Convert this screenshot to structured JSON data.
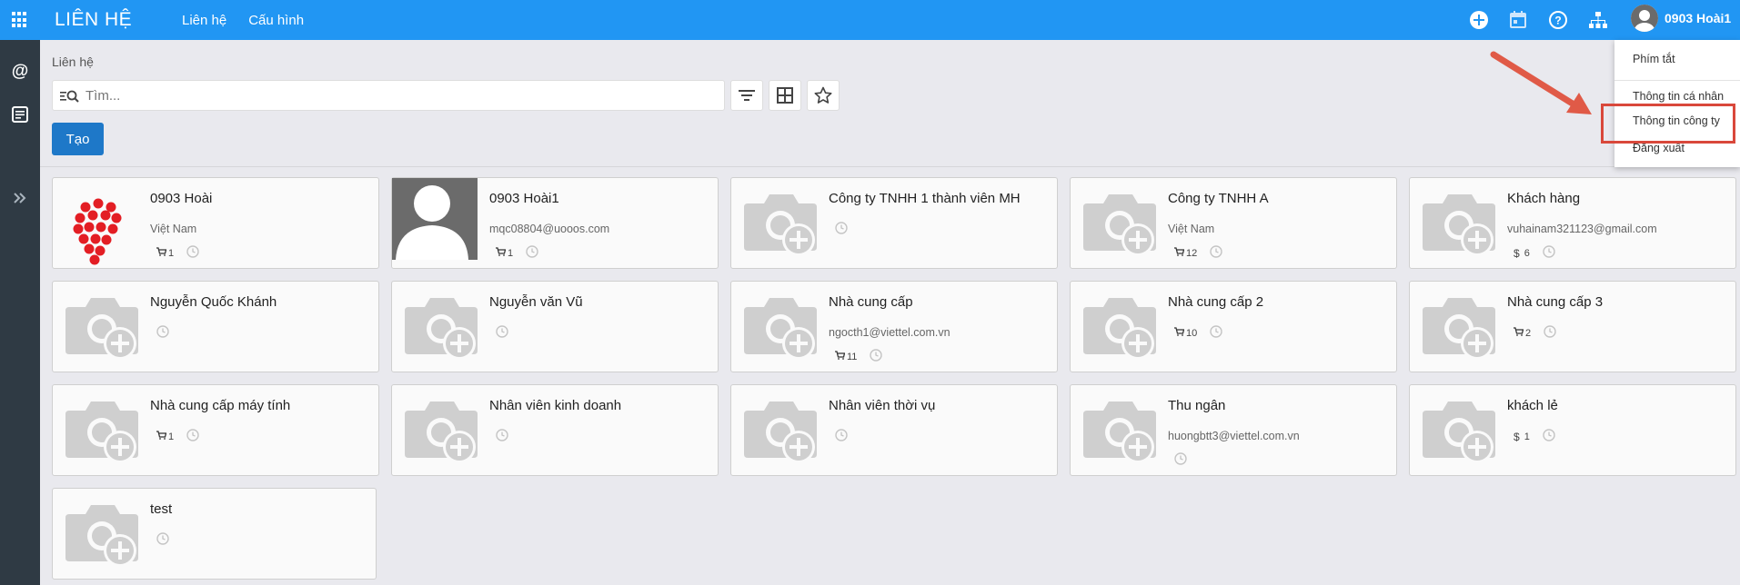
{
  "header": {
    "app_title": "LIÊN HỆ",
    "menu": [
      "Liên hệ",
      "Cấu hình"
    ],
    "user_name": "0903 Hoài1"
  },
  "control_panel": {
    "breadcrumb": "Liên hệ",
    "search_placeholder": "Tìm...",
    "create_label": "Tạo"
  },
  "user_menu": {
    "items": [
      "Phím tắt",
      "Thông tin cá nhân",
      "Thông tin công ty",
      "Đăng xuất"
    ],
    "highlighted": "Thông tin công ty"
  },
  "contacts": [
    {
      "name": "0903 Hoài",
      "sub": "Việt Nam",
      "badges": [
        {
          "type": "cart",
          "value": "1"
        }
      ],
      "image": "logo"
    },
    {
      "name": "0903 Hoài1",
      "sub": "mqc08804@uooos.com",
      "badges": [
        {
          "type": "cart",
          "value": "1"
        }
      ],
      "image": "person"
    },
    {
      "name": "Công ty TNHH 1 thành viên MH",
      "sub": "",
      "badges": [],
      "image": "placeholder"
    },
    {
      "name": "Công ty TNHH A",
      "sub": "Việt Nam",
      "badges": [
        {
          "type": "cart",
          "value": "12"
        }
      ],
      "image": "placeholder"
    },
    {
      "name": "Khách hàng",
      "sub": "vuhainam321123@gmail.com",
      "badges": [
        {
          "type": "money",
          "value": "6"
        }
      ],
      "image": "placeholder"
    },
    {
      "name": "Nguyễn Quốc Khánh",
      "sub": "",
      "badges": [],
      "image": "placeholder"
    },
    {
      "name": "Nguyễn văn Vũ",
      "sub": "",
      "badges": [],
      "image": "placeholder"
    },
    {
      "name": "Nhà cung cấp",
      "sub": "ngocth1@viettel.com.vn",
      "badges": [
        {
          "type": "cart",
          "value": "11"
        }
      ],
      "image": "placeholder"
    },
    {
      "name": "Nhà cung cấp 2",
      "sub": "",
      "badges": [
        {
          "type": "cart",
          "value": "10"
        }
      ],
      "image": "placeholder"
    },
    {
      "name": "Nhà cung cấp 3",
      "sub": "",
      "badges": [
        {
          "type": "cart",
          "value": "2"
        }
      ],
      "image": "placeholder"
    },
    {
      "name": "Nhà cung cấp máy tính",
      "sub": "",
      "badges": [
        {
          "type": "cart",
          "value": "1"
        }
      ],
      "image": "placeholder"
    },
    {
      "name": "Nhân viên kinh doanh",
      "sub": "",
      "badges": [],
      "image": "placeholder"
    },
    {
      "name": "Nhân viên thời vụ",
      "sub": "",
      "badges": [],
      "image": "placeholder"
    },
    {
      "name": "Thu ngân",
      "sub": "huongbtt3@viettel.com.vn",
      "badges": [],
      "image": "placeholder"
    },
    {
      "name": "khách lẻ",
      "sub": "",
      "badges": [
        {
          "type": "money",
          "value": "1"
        }
      ],
      "image": "placeholder"
    },
    {
      "name": "test",
      "sub": "",
      "badges": [],
      "image": "placeholder"
    }
  ],
  "colors": {
    "topbar": "#2196f3",
    "rail": "#2f3a44",
    "create_button": "#1e78c8",
    "highlight_box": "#d9483b"
  }
}
